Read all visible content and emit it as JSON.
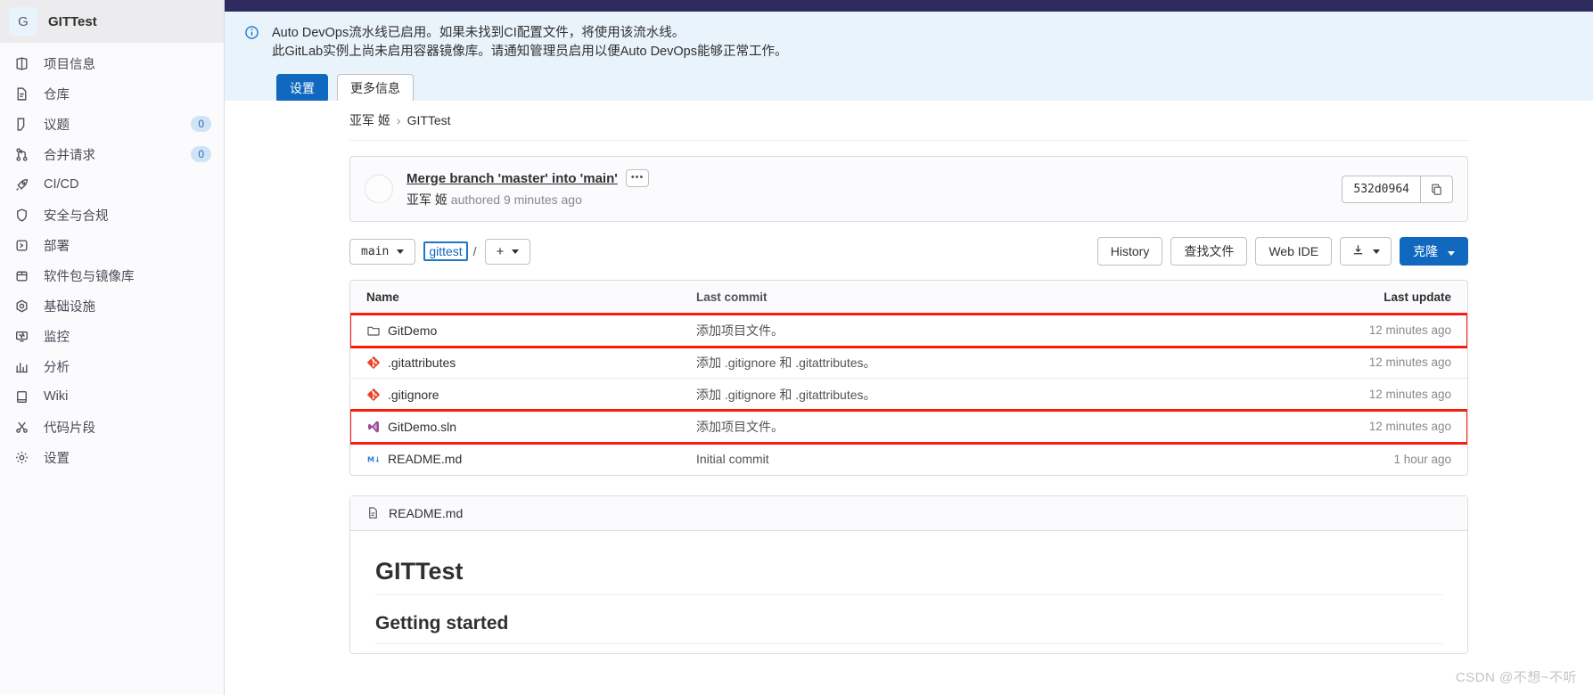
{
  "sidebar": {
    "project": {
      "initial": "G",
      "name": "GITTest"
    },
    "items": [
      {
        "label": "项目信息",
        "icon": "project-info-icon",
        "badge": null
      },
      {
        "label": "仓库",
        "icon": "repository-icon",
        "badge": null
      },
      {
        "label": "议题",
        "icon": "issues-icon",
        "badge": "0"
      },
      {
        "label": "合并请求",
        "icon": "merge-requests-icon",
        "badge": "0"
      },
      {
        "label": "CI/CD",
        "icon": "cicd-rocket-icon",
        "badge": null
      },
      {
        "label": "安全与合规",
        "icon": "shield-icon",
        "badge": null
      },
      {
        "label": "部署",
        "icon": "deployments-icon",
        "badge": null
      },
      {
        "label": "软件包与镜像库",
        "icon": "package-icon",
        "badge": null
      },
      {
        "label": "基础设施",
        "icon": "infrastructure-icon",
        "badge": null
      },
      {
        "label": "监控",
        "icon": "monitor-icon",
        "badge": null
      },
      {
        "label": "分析",
        "icon": "analytics-chart-icon",
        "badge": null
      },
      {
        "label": "Wiki",
        "icon": "book-icon",
        "badge": null
      },
      {
        "label": "代码片段",
        "icon": "snippet-scissors-icon",
        "badge": null
      },
      {
        "label": "设置",
        "icon": "gear-icon",
        "badge": null
      }
    ]
  },
  "alert": {
    "icon": "info-icon",
    "line1": "Auto DevOps流水线已启用。如果未找到CI配置文件，将使用该流水线。",
    "line2": "此GitLab实例上尚未启用容器镜像库。请通知管理员启用以便Auto DevOps能够正常工作。",
    "settings_label": "设置",
    "more_info_label": "更多信息"
  },
  "breadcrumb": {
    "owner": "亚军 姬",
    "separator": "›",
    "project": "GITTest"
  },
  "commit": {
    "title": "Merge branch 'master' into 'main'",
    "more_label": "•••",
    "author": "亚军 姬",
    "meta": "authored 9 minutes ago",
    "sha": "532d0964",
    "copy_icon": "copy-icon"
  },
  "toolbar": {
    "branch": "main",
    "path_root": "gittest",
    "path_sep": "/",
    "add_label": "+",
    "history_label": "History",
    "find_file_label": "查找文件",
    "web_ide_label": "Web IDE",
    "download_icon": "download-icon",
    "clone_label": "克隆"
  },
  "file_table": {
    "columns": {
      "name": "Name",
      "commit": "Last commit",
      "update": "Last update"
    },
    "rows": [
      {
        "name": "GitDemo",
        "icon": "folder-icon",
        "commit": "添加项目文件。",
        "update": "12 minutes ago",
        "highlight": true
      },
      {
        "name": ".gitattributes",
        "icon": "git-file-icon",
        "commit": "添加 .gitignore 和 .gitattributes。",
        "update": "12 minutes ago",
        "highlight": false
      },
      {
        "name": ".gitignore",
        "icon": "git-file-icon",
        "commit": "添加 .gitignore 和 .gitattributes。",
        "update": "12 minutes ago",
        "highlight": false
      },
      {
        "name": "GitDemo.sln",
        "icon": "visual-studio-icon",
        "commit": "添加项目文件。",
        "update": "12 minutes ago",
        "highlight": true
      },
      {
        "name": "README.md",
        "icon": "markdown-icon",
        "commit": "Initial commit",
        "update": "1 hour ago",
        "highlight": false
      }
    ]
  },
  "readme": {
    "filename": "README.md",
    "file_icon": "document-icon",
    "heading": "GITTest",
    "subheading": "Getting started"
  },
  "watermark": "CSDN @不想~不听",
  "colors": {
    "navbar": "#2e2c5f",
    "alert_bg": "#e9f3fc",
    "primary": "#1068bf",
    "highlight": "#fc1b0e",
    "badge_bg": "#cfe4f7"
  }
}
